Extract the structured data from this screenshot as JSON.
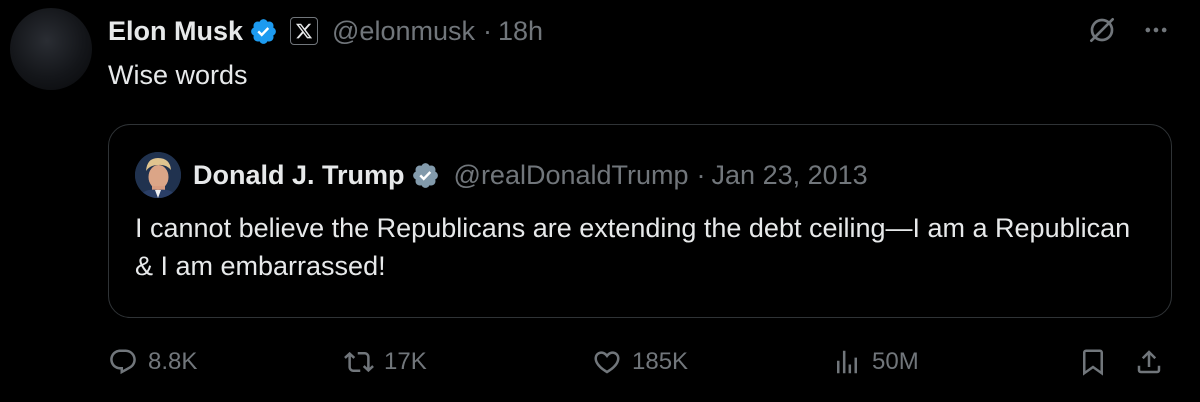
{
  "tweet": {
    "author_name": "Elon Musk",
    "handle": "@elonmusk",
    "time": "18h",
    "separator": "·",
    "text": "Wise words"
  },
  "quoted": {
    "author_name": "Donald J. Trump",
    "handle": "@realDonaldTrump",
    "date": "Jan 23, 2013",
    "separator": "·",
    "text": "I cannot believe the Republicans are extending the debt ceiling—I am a Republican & I am embarrassed!"
  },
  "actions": {
    "replies": "8.8K",
    "reposts": "17K",
    "likes": "185K",
    "views": "50M"
  },
  "colors": {
    "background": "#000000",
    "primary_text": "#e7e9ea",
    "secondary_text": "#71767b",
    "verified_badge": "#1d9bf0",
    "border": "#2f3336"
  },
  "icons": {
    "verified": "verified-badge-icon",
    "affiliate": "x-logo-icon",
    "grok": "grok-icon",
    "more": "more-icon",
    "reply": "reply-icon",
    "repost": "repost-icon",
    "like": "heart-icon",
    "views": "views-icon",
    "bookmark": "bookmark-icon",
    "share": "share-icon"
  }
}
